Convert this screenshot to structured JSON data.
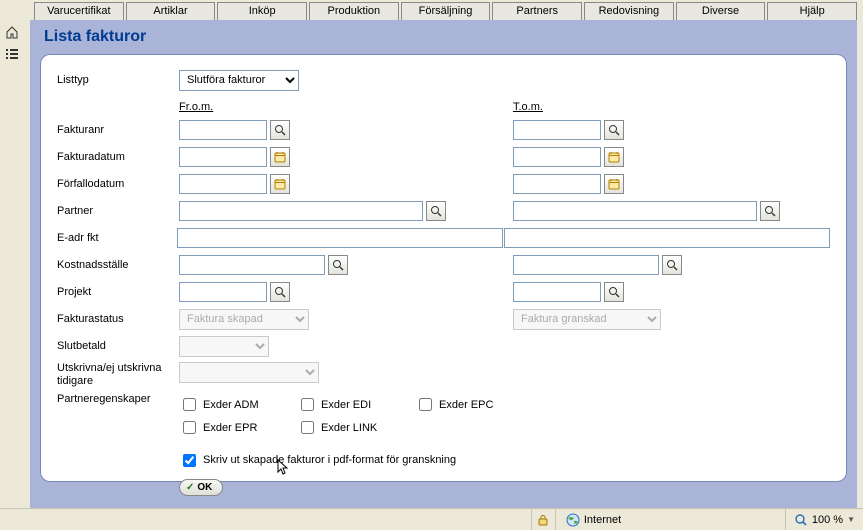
{
  "colors": {
    "accent": "#003a91",
    "panel_bg": "#aab4d8"
  },
  "tabs": [
    "Varucertifikat",
    "Artiklar",
    "Inköp",
    "Produktion",
    "Försäljning",
    "Partners",
    "Redovisning",
    "Diverse",
    "Hjälp"
  ],
  "page_title": "Lista fakturor",
  "labels": {
    "listtyp": "Listtyp",
    "from": "Fr.o.m.",
    "to": "T.o.m.",
    "fakturanr": "Fakturanr",
    "fakturadatum": "Fakturadatum",
    "forfallodatum": "Förfallodatum",
    "partner": "Partner",
    "eadr": "E-adr fkt",
    "kostnadsstalle": "Kostnadsställe",
    "projekt": "Projekt",
    "fakturastatus": "Fakturastatus",
    "slutbetald": "Slutbetald",
    "utskrivna": "Utskrivna/ej utskrivna tidigare",
    "partneregenskaper": "Partneregenskaper",
    "print_pdf": "Skriv ut skapade fakturor i pdf-format för granskning",
    "ok": "OK"
  },
  "listtyp": {
    "selected": "Slutföra fakturor",
    "options": [
      "Slutföra fakturor"
    ]
  },
  "fakturanr": {
    "from": "",
    "to": ""
  },
  "fakturadatum": {
    "from": "",
    "to": ""
  },
  "forfallodatum": {
    "from": "",
    "to": ""
  },
  "partner": {
    "from": "",
    "to": ""
  },
  "eadr": {
    "from": "",
    "to": ""
  },
  "kostnadsstalle": {
    "from": "",
    "to": ""
  },
  "projekt": {
    "from": "",
    "to": ""
  },
  "fakturastatus": {
    "from_selected": "Faktura skapad",
    "to_selected": "Faktura granskad"
  },
  "slutbetald": {
    "selected": ""
  },
  "utskrivna": {
    "selected": ""
  },
  "partneregenskaper": {
    "items": [
      {
        "label": "Exder ADM",
        "checked": false
      },
      {
        "label": "Exder EDI",
        "checked": false
      },
      {
        "label": "Exder EPC",
        "checked": false
      },
      {
        "label": "Exder EPR",
        "checked": false
      },
      {
        "label": "Exder LINK",
        "checked": false
      }
    ]
  },
  "print_pdf_checked": true,
  "statusbar": {
    "zone": "Internet",
    "zoom": "100 %"
  }
}
